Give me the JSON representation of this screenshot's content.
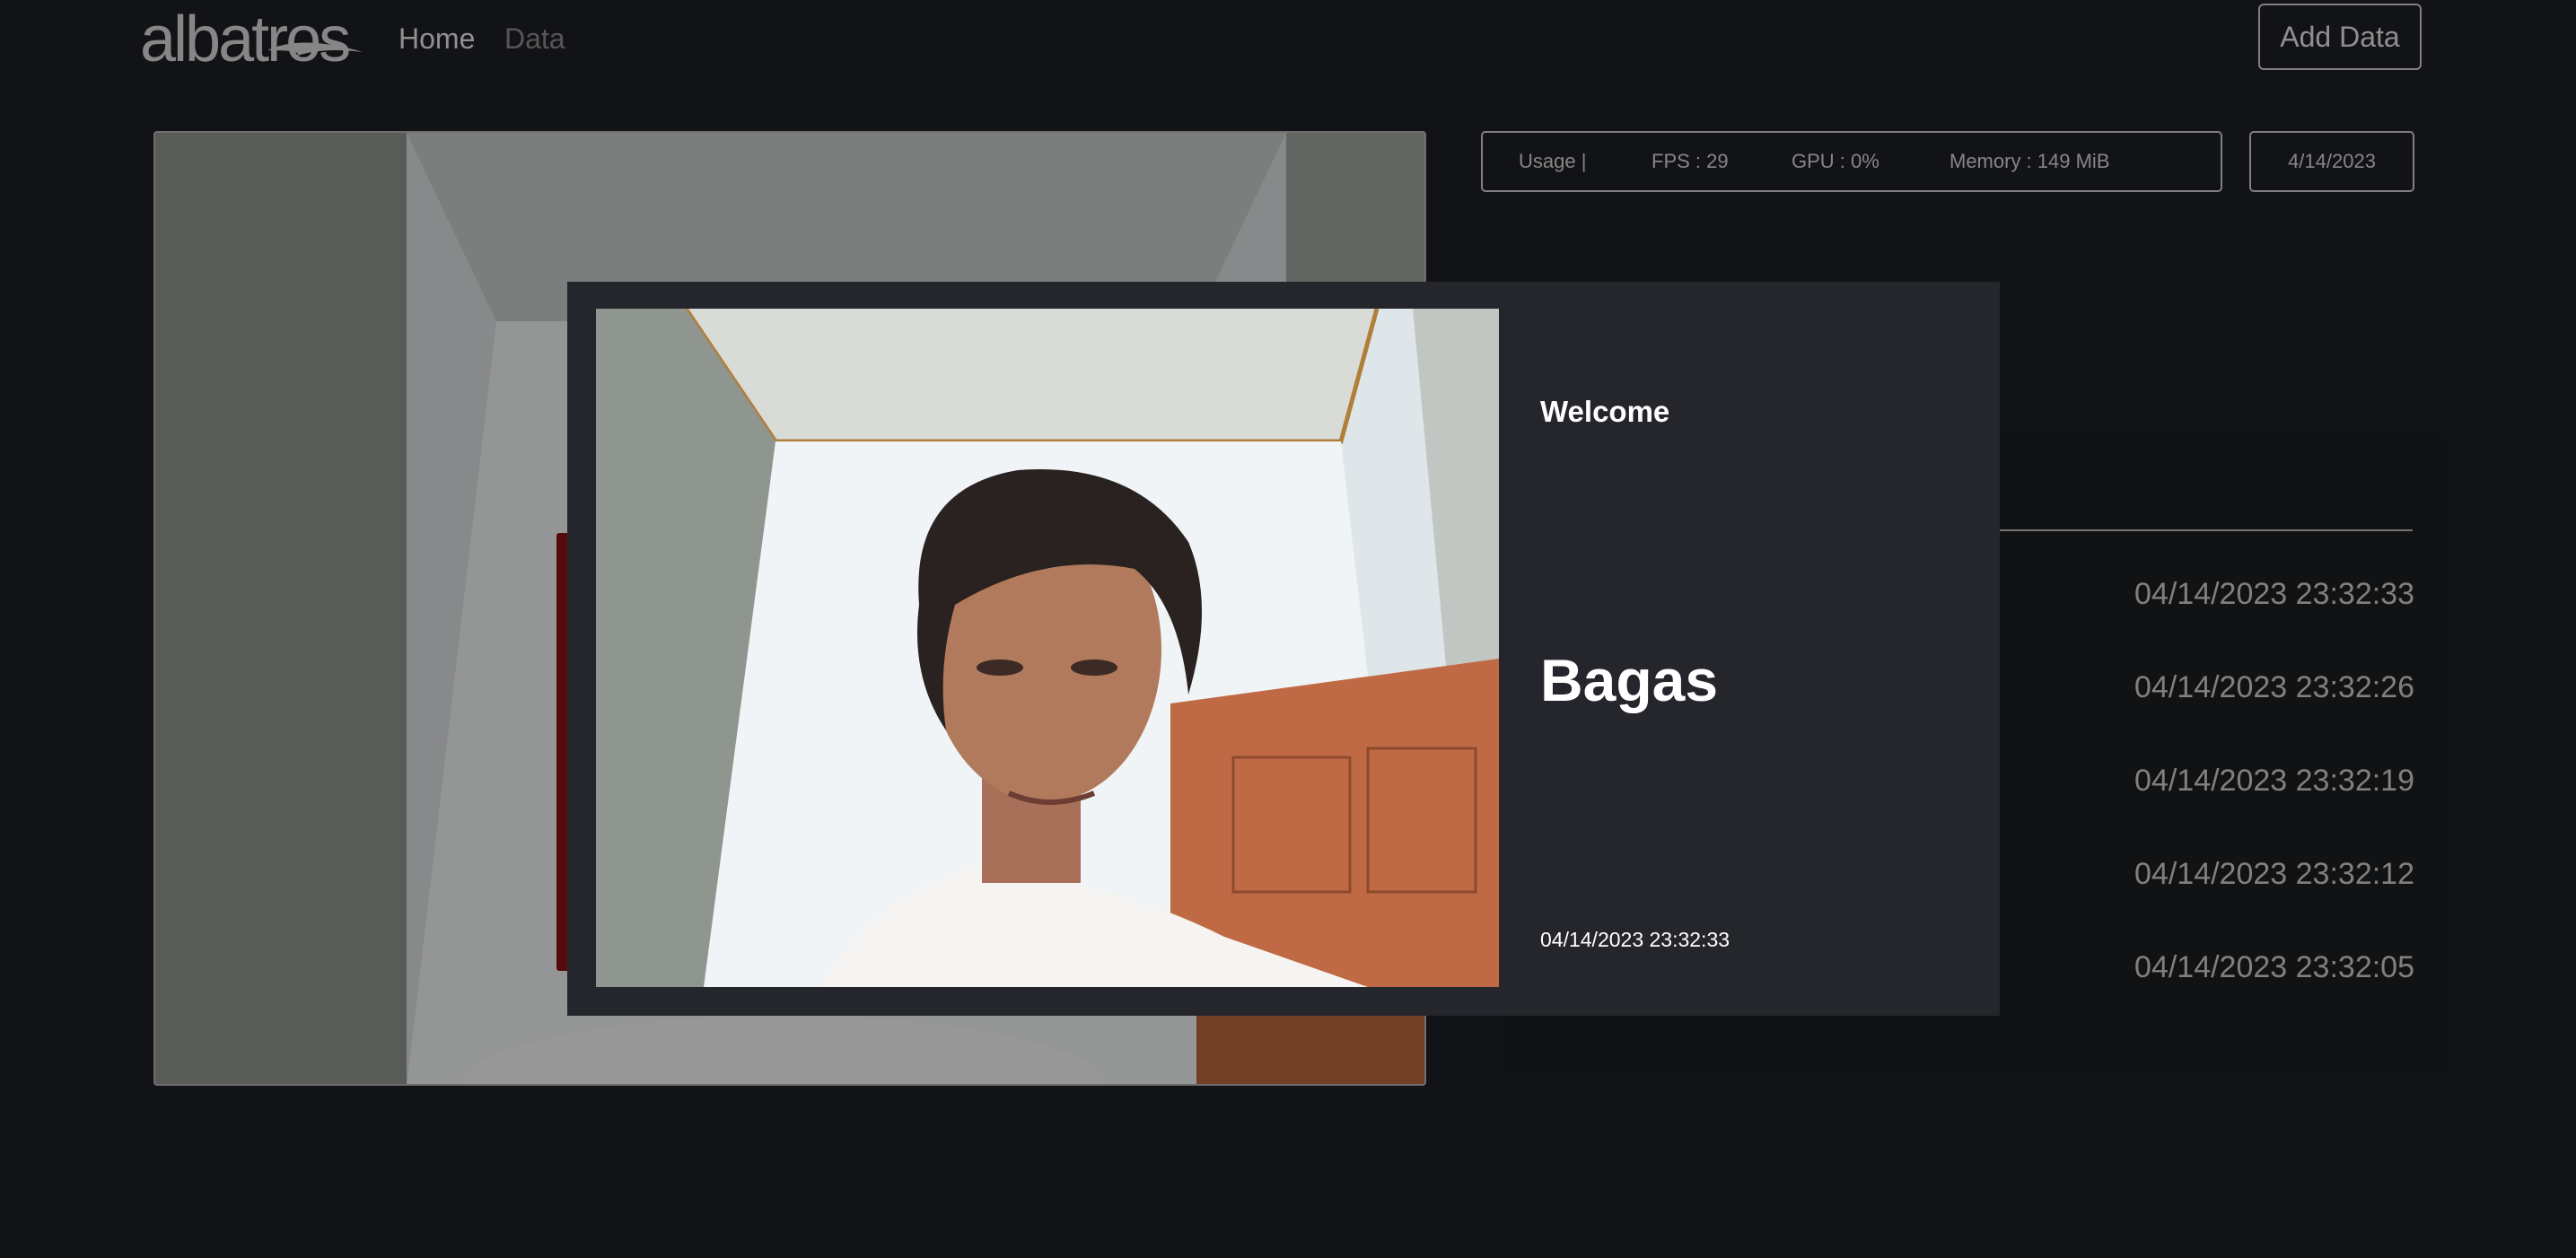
{
  "navbar": {
    "logo_text": "albatros",
    "links": [
      {
        "label": "Home",
        "active": true
      },
      {
        "label": "Data",
        "active": false
      }
    ],
    "add_button_label": "Add Data"
  },
  "usage": {
    "label": "Usage |",
    "fps": "FPS : 29",
    "gpu": "GPU : 0%",
    "memory": "Memory : 149 MiB"
  },
  "date": "4/14/2023",
  "history": [
    "04/14/2023 23:32:33",
    "04/14/2023 23:32:26",
    "04/14/2023 23:32:19",
    "04/14/2023 23:32:12",
    "04/14/2023 23:32:05"
  ],
  "modal": {
    "welcome": "Welcome",
    "name": "Bagas",
    "timestamp": "04/14/2023 23:32:33"
  },
  "colors": {
    "background": "#121316",
    "modal_background": "#24262b",
    "panel_background": "#1c1d21",
    "accent_red": "#8a1212"
  }
}
